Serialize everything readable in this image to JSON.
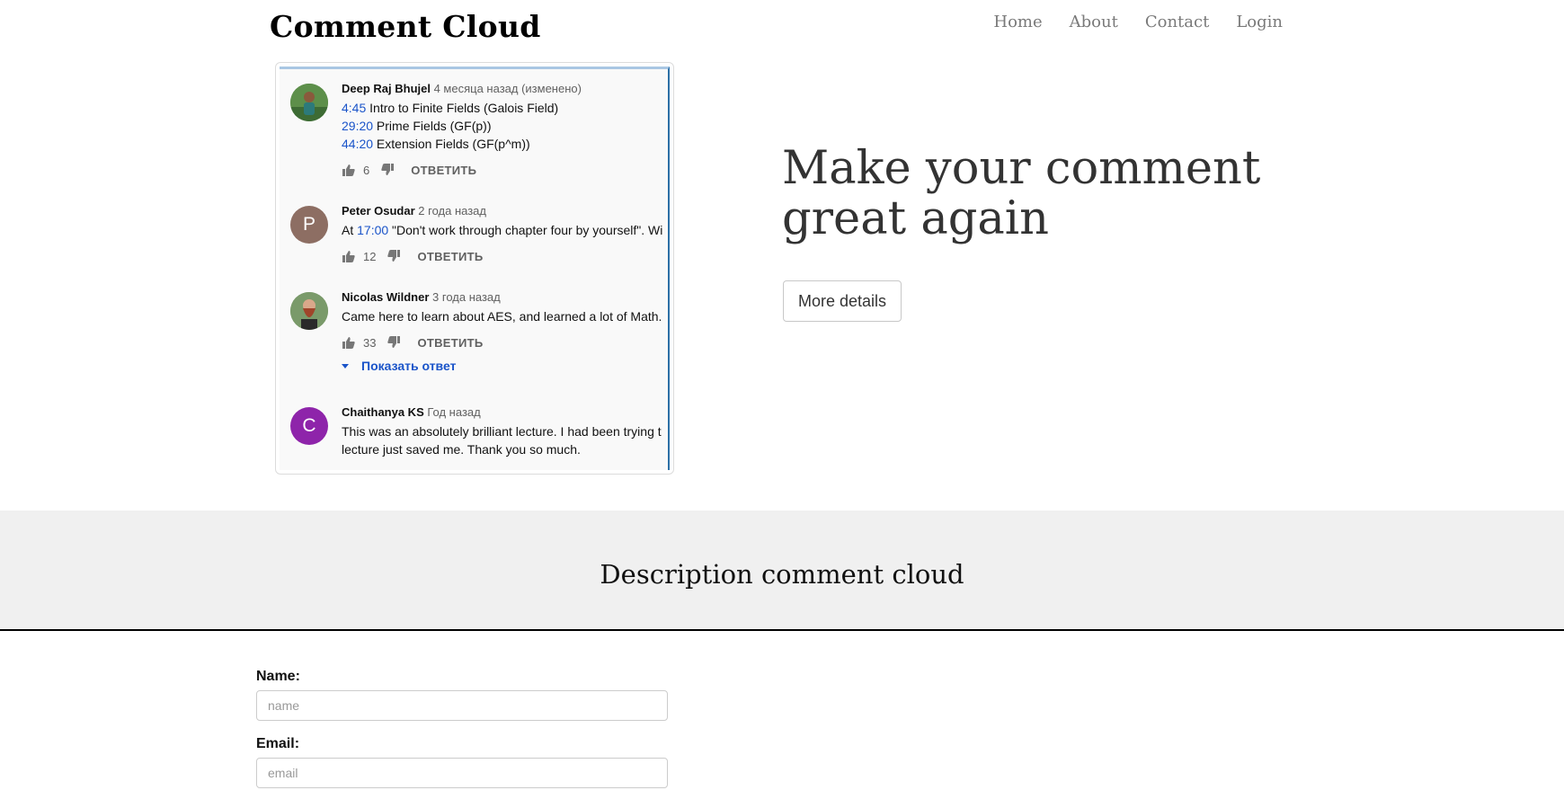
{
  "header": {
    "brand": "Comment Cloud",
    "nav": [
      "Home",
      "About",
      "Contact",
      "Login"
    ]
  },
  "preview": {
    "comments": [
      {
        "author": "Deep Raj Bhujel",
        "time": "4 месяца назад (изменено)",
        "avatar": "photo",
        "lines": [
          {
            "ts": "4:45",
            "text": " Intro to Finite Fields (Galois Field)"
          },
          {
            "ts": "29:20",
            "text": " Prime Fields (GF(p))"
          },
          {
            "ts": "44:20",
            "text": " Extension Fields (GF(p^m))"
          }
        ],
        "likes": "6",
        "reply": "ОТВЕТИТЬ"
      },
      {
        "author": "Peter Osudar",
        "time": "2 года назад",
        "avatar": "P",
        "avatar_color": "#8d6e63",
        "pre": "At ",
        "ts": "17:00",
        "text": " \"Don't work through chapter four by yourself\". Wi",
        "likes": "12",
        "reply": "ОТВЕТИТЬ"
      },
      {
        "author": "Nicolas Wildner",
        "time": "3 года назад",
        "avatar": "photo",
        "text": "Came here to learn about AES, and learned a lot of Math.",
        "likes": "33",
        "reply": "ОТВЕТИТЬ",
        "show_reply": "Показать ответ"
      },
      {
        "author": "Chaithanya KS",
        "time": "Год назад",
        "avatar": "C",
        "avatar_color": "#8e24aa",
        "line1": "This was an absolutely brilliant lecture. I had been trying t",
        "line2": "lecture just saved me. Thank you so much."
      }
    ]
  },
  "hero": {
    "title": "Make your comment great again",
    "button": "More details"
  },
  "description": {
    "title": "Description comment cloud"
  },
  "form": {
    "name_label": "Name:",
    "name_placeholder": "name",
    "email_label": "Email:",
    "email_placeholder": "email"
  },
  "colors": {
    "link_blue": "#1a54c9",
    "band_bg": "#f0f0f0",
    "nav_text": "#7a7a7a"
  }
}
